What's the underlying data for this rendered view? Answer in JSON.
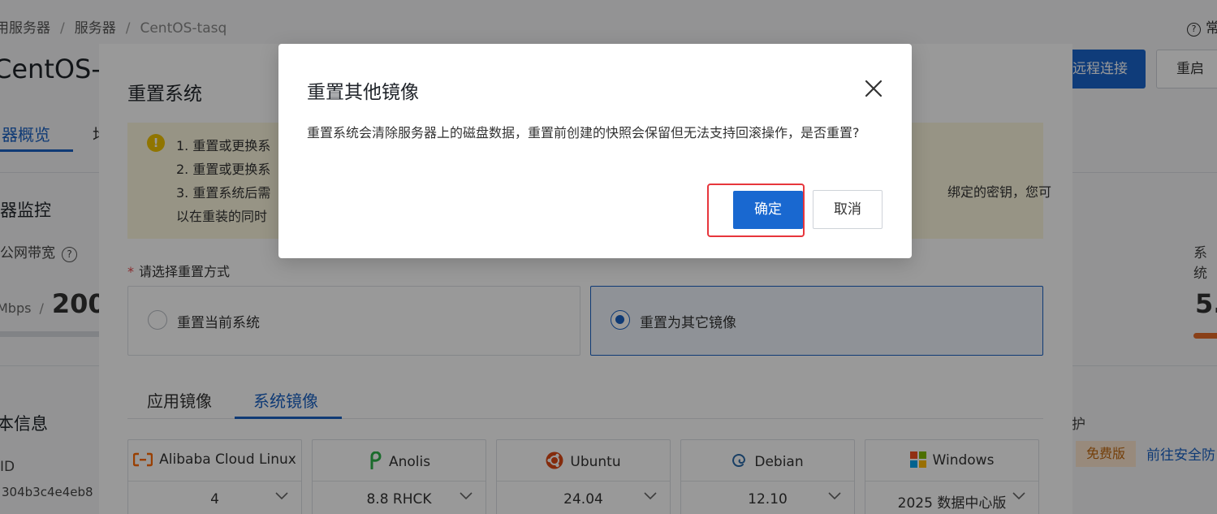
{
  "breadcrumb": {
    "items": [
      "用服务器",
      "服务器",
      "CentOS-tasq"
    ]
  },
  "header": {
    "help_label": "常",
    "title": "CentOS-",
    "remote_button": "远程连接",
    "restart_button": "重启"
  },
  "main_tabs": {
    "active": "器概览",
    "next": "均"
  },
  "monitor": {
    "title": "器监控",
    "bandwidth_label": "公网带宽",
    "bandwidth_unit": "Mbps",
    "bandwidth_sep": "/",
    "bandwidth_value": "200",
    "system_label": "系统",
    "system_value": "5."
  },
  "info": {
    "title": "本信息",
    "id_label": "ID",
    "id_value": "304b3c4e4eb8",
    "protection_label": "护",
    "free_badge": "免费版",
    "security_link": "前往安全防"
  },
  "drawer": {
    "title": "重置系统",
    "notice_lines": [
      "1. 重置或更换系",
      "2. 重置或更换系",
      "3. 重置系统后需",
      "以在重装的同时"
    ],
    "notice_right": "绑定的密钥，您可",
    "reset_method_label": "请选择重置方式",
    "reset_method_required": "*",
    "options": [
      {
        "label": "重置当前系统",
        "checked": false
      },
      {
        "label": "重置为其它镜像",
        "checked": true
      }
    ],
    "image_tabs": [
      "应用镜像",
      "系统镜像"
    ],
    "active_image_tab": "系统镜像",
    "os_cards": [
      {
        "name": "Alibaba Cloud Linux",
        "icon": "alibaba-cloud-icon",
        "version": "4"
      },
      {
        "name": "Anolis",
        "icon": "anolis-icon",
        "version": "8.8 RHCK"
      },
      {
        "name": "Ubuntu",
        "icon": "ubuntu-icon",
        "version": "24.04"
      },
      {
        "name": "Debian",
        "icon": "debian-icon",
        "version": "12.10"
      },
      {
        "name": "Windows",
        "icon": "windows-icon",
        "version": "2025 数据中心版"
      }
    ]
  },
  "modal": {
    "title": "重置其他镜像",
    "body": "重置系统会清除服务器上的磁盘数据，重置前创建的快照会保留但无法支持回滚操作，是否重置?",
    "ok_button": "确定",
    "cancel_button": "取消"
  },
  "colors": {
    "primary": "#1968d0",
    "highlight": "#e7363c",
    "notice_bg": "#fcf7de",
    "warning_icon": "#f0c300"
  }
}
